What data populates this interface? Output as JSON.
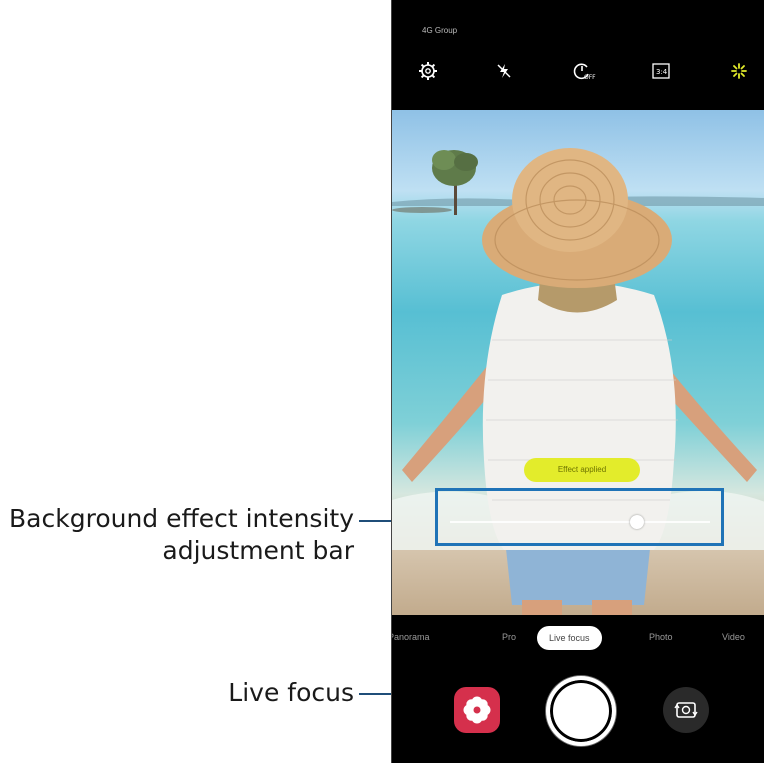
{
  "status": {
    "text": "4G Group"
  },
  "top_bar": {
    "icons": [
      "settings-gear-icon",
      "flash-off-icon",
      "timer-off-icon",
      "ratio-3-4-icon",
      "sparkle-filter-icon"
    ],
    "ratio_label": "3:4",
    "accent_color": "#e3ec2b"
  },
  "viewfinder": {
    "effect_label": "Effect applied",
    "slider_level": 0.72
  },
  "modes": {
    "items": [
      "Panorama",
      "Pro",
      "Live focus",
      "Photo",
      "Video"
    ],
    "selected": "Live focus"
  },
  "bottom_bar": {
    "effect_button_color": "#d5304c",
    "icons": [
      "flower-effect-icon",
      "shutter-icon",
      "switch-camera-icon"
    ]
  },
  "callouts": {
    "intensity_bar_line1": "Background effect intensity",
    "intensity_bar_line2": "adjustment bar",
    "live_focus": "Live focus",
    "line_color": "#1f4e79"
  }
}
